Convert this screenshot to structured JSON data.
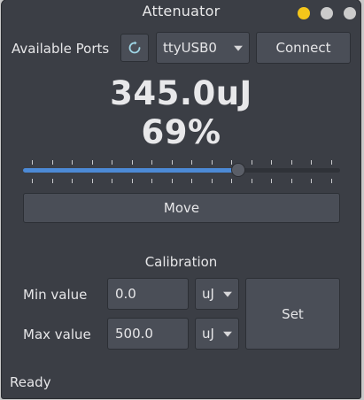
{
  "window": {
    "title": "Attenuator"
  },
  "ports": {
    "label": "Available Ports",
    "selected": "ttyUSB0",
    "refresh_icon": "refresh-icon",
    "connect_label": "Connect"
  },
  "readout": {
    "energy": "345.0uJ",
    "percent": "69%"
  },
  "slider": {
    "value_fraction": 0.69,
    "tick_count": 16
  },
  "move_label": "Move",
  "calibration": {
    "title": "Calibration",
    "min_label": "Min value",
    "min_value": "0.0",
    "min_unit": "uJ",
    "max_label": "Max value",
    "max_value": "500.0",
    "max_unit": "uJ",
    "set_label": "Set"
  },
  "status": "Ready",
  "colors": {
    "accent": "#4c8ad6",
    "minimize": "#f4c61a",
    "background": "#3b3e45"
  }
}
